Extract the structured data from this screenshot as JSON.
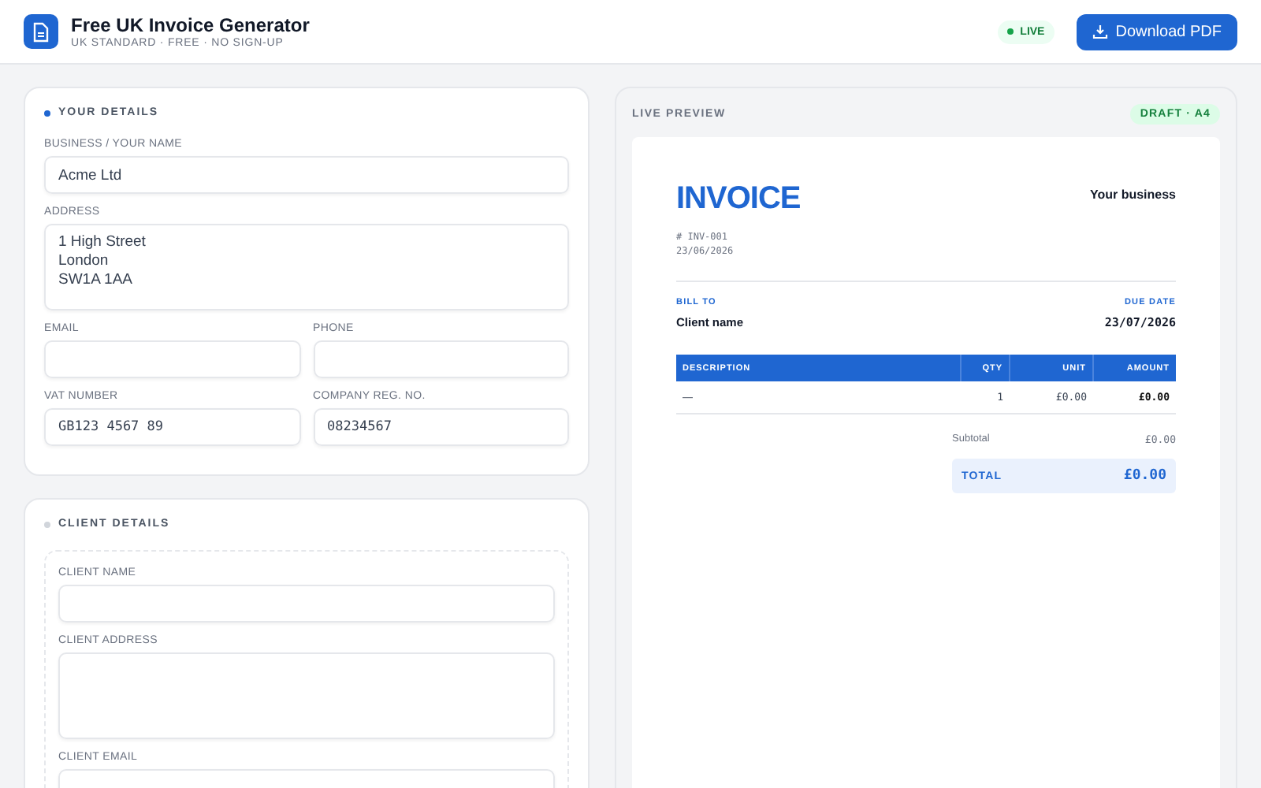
{
  "header": {
    "title": "Free UK Invoice Generator",
    "subtitle": "UK STANDARD · FREE · NO SIGN-UP",
    "status": "LIVE",
    "download_button": "Download PDF"
  },
  "sections": [
    {
      "title": "YOUR DETAILS",
      "active": true,
      "boxed": false,
      "rows": [
        [
          {
            "label": "BUSINESS / YOUR NAME",
            "kind": "text",
            "value": "Acme Ltd"
          }
        ],
        [
          {
            "label": "ADDRESS",
            "kind": "textarea",
            "value": "1 High Street\nLondon\nSW1A 1AA"
          }
        ],
        [
          {
            "label": "EMAIL",
            "kind": "text"
          },
          {
            "label": "PHONE",
            "kind": "text"
          }
        ],
        [
          {
            "label": "VAT NUMBER",
            "kind": "code",
            "value": "GB123 4567 89"
          },
          {
            "label": "COMPANY REG. NO.",
            "kind": "code",
            "value": "08234567"
          }
        ]
      ]
    },
    {
      "title": "CLIENT DETAILS",
      "active": false,
      "boxed": true,
      "rows": [
        [
          {
            "label": "CLIENT NAME",
            "kind": "text"
          }
        ],
        [
          {
            "label": "CLIENT ADDRESS",
            "kind": "textarea"
          }
        ],
        [
          {
            "label": "CLIENT EMAIL",
            "kind": "text"
          }
        ]
      ]
    }
  ],
  "preview": {
    "title": "LIVE PREVIEW",
    "badge": "DRAFT · A4",
    "invoice": {
      "heading": "INVOICE",
      "business": "Your business",
      "number": "# INV-001",
      "date": "23/06/2026",
      "bill_to_label": "BILL TO",
      "client": "Client name",
      "due_label": "DUE DATE",
      "due_date": "23/07/2026",
      "columns": [
        "DESCRIPTION",
        "QTY",
        "UNIT",
        "AMOUNT"
      ],
      "rows": [
        [
          "—",
          "1",
          "£0.00",
          "£0.00"
        ]
      ],
      "subtotal_label": "Subtotal",
      "subtotal": "£0.00",
      "total_label": "TOTAL",
      "total": "£0.00"
    }
  }
}
